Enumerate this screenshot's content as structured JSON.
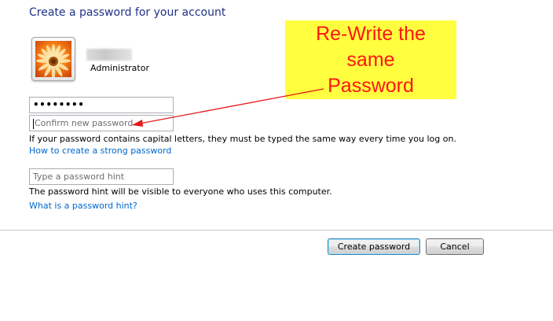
{
  "header": {
    "title": "Create a password for your account"
  },
  "account": {
    "avatar_icon": "flower-avatar-icon",
    "role": "Administrator"
  },
  "form": {
    "password_value": "••••••••",
    "confirm_placeholder": "Confirm new password",
    "caps_note": "If your password contains capital letters, they must be typed the same way every time you log on.",
    "strong_link": "How to create a strong password",
    "hint_placeholder": "Type a password hint",
    "hint_note": "The password hint will be visible to everyone who uses this computer.",
    "hint_link": "What is a password hint?"
  },
  "actions": {
    "create_label": "Create password",
    "cancel_label": "Cancel"
  },
  "annotation": {
    "lines": [
      "Re-Write the",
      "same",
      "Password"
    ],
    "arrow_icon": "red-arrow-icon",
    "text_color": "#ff1515",
    "background_color": "#ffff3f"
  },
  "colors": {
    "title": "#1e3287",
    "link": "#0066cc",
    "button_border_default": "#3c7fb1"
  }
}
